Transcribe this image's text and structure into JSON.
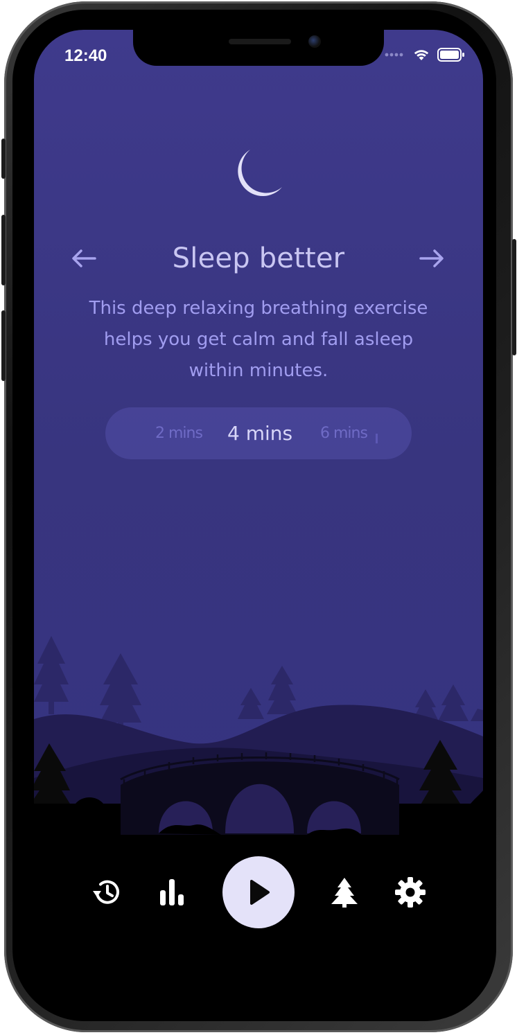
{
  "status_bar": {
    "time": "12:40",
    "icons": [
      "signal-dots-icon",
      "wifi-icon",
      "battery-icon"
    ]
  },
  "exercise": {
    "icon": "moon-icon",
    "title": "Sleep better",
    "description": "This deep relaxing breathing exercise helps you get calm and fall asleep within minutes.",
    "prev_icon": "arrow-left-icon",
    "next_icon": "arrow-right-icon"
  },
  "duration_picker": {
    "options": [
      "2 mins",
      "4 mins",
      "6 mins"
    ],
    "selected": "4 mins"
  },
  "bottom_nav": {
    "items": [
      "history-icon",
      "stats-icon",
      "play-icon",
      "tree-icon",
      "settings-icon"
    ]
  },
  "colors": {
    "background_top": "#3f3a8c",
    "title_text": "#c9c6f2",
    "description_text": "#a19df0",
    "play_button": "#e4e2f9",
    "icon_white": "#ffffff"
  }
}
